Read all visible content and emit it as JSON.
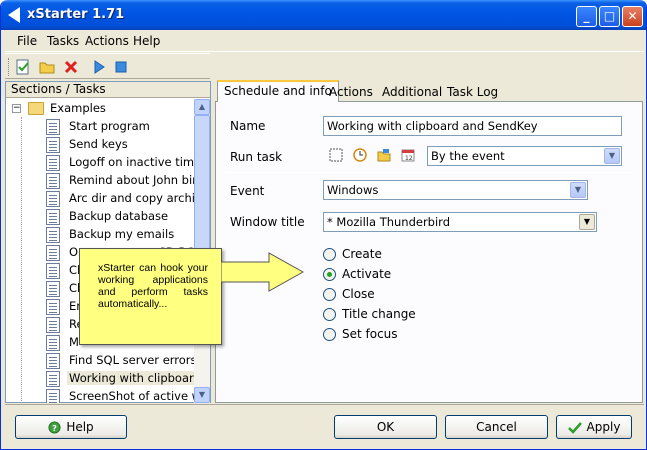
{
  "window": {
    "title": "xStarter 1.71"
  },
  "menu": {
    "file": "File",
    "tasks": "Tasks",
    "actions": "Actions",
    "help": "Help"
  },
  "toolbar": {
    "icons": [
      "new-task-icon",
      "open-folder-icon",
      "delete-icon",
      "run-icon",
      "stop-icon"
    ]
  },
  "sections": {
    "header": "Sections / Tasks",
    "root": "Examples",
    "items": [
      "Start program",
      "Send keys",
      "Logoff on inactive time",
      "Remind about John birt...",
      "Arc dir and copy archive",
      "Backup database",
      "Backup my emails",
      "Op",
      "Cl",
      "Ch",
      "Er",
      "Re",
      "M",
      "Find SQL server errors",
      "Working with clipboard ...",
      "ScreenShot of active w..."
    ],
    "item_7_suffix": "CD ROM",
    "selected_index": 14
  },
  "tabs": [
    "Schedule and info",
    "Actions",
    "Additional",
    "Task Log"
  ],
  "form": {
    "name_label": "Name",
    "name_value": "Working with clipboard and SendKey",
    "run_task_label": "Run task",
    "run_task_value": "By the event",
    "event_label": "Event",
    "event_value": "Windows",
    "window_title_label": "Window title",
    "window_title_value": "* Mozilla Thunderbird",
    "radios": [
      "Create",
      "Activate",
      "Close",
      "Title change",
      "Set focus"
    ],
    "selected_radio": 1
  },
  "callout": {
    "text": "xStarter can hook your working applications and perform tasks automatically..."
  },
  "buttons": {
    "help": "Help",
    "ok": "OK",
    "cancel": "Cancel",
    "apply": "Apply"
  },
  "colors": {
    "titlebar": "#0054e3",
    "callout": "#ffff80",
    "radio_on": "#21a121",
    "tab_accent": "#ffc83c"
  }
}
